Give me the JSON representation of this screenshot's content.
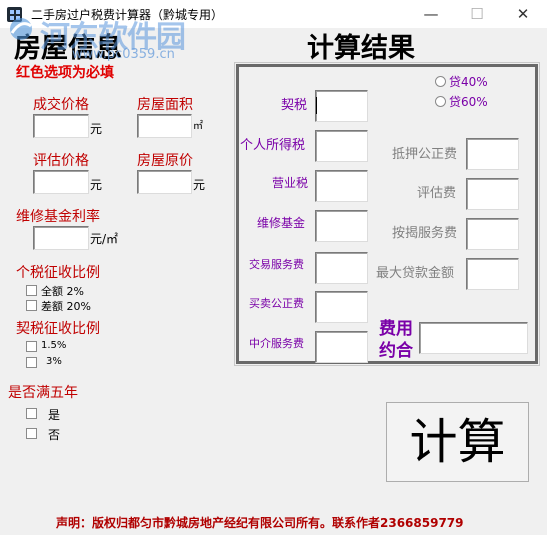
{
  "window": {
    "title": "二手房过户税费计算器（黔城专用）",
    "min": "—",
    "max": "☐",
    "close": "✕"
  },
  "watermark": {
    "text": "河东软件园",
    "url": "www.pc0359.cn"
  },
  "left": {
    "heading": "房屋信息",
    "required_note": "红色选项为必填",
    "deal_price": {
      "label": "成交价格",
      "unit": "元",
      "value": ""
    },
    "area": {
      "label": "房屋面积",
      "unit": "㎡",
      "value": ""
    },
    "appraised_price": {
      "label": "评估价格",
      "unit": "元",
      "value": ""
    },
    "original_price": {
      "label": "房屋原价",
      "unit": "元",
      "value": ""
    },
    "maintenance_rate": {
      "label": "维修基金利率",
      "unit": "元/㎡",
      "value": ""
    },
    "income_tax_ratio": {
      "label": "个税征收比例",
      "options": [
        "全额  2%",
        "差额 20%"
      ]
    },
    "deed_tax_ratio": {
      "label": "契税征收比例",
      "options": [
        "1.5%",
        "3%"
      ]
    },
    "five_years": {
      "label": "是否满五年",
      "options": [
        "是",
        "否"
      ]
    }
  },
  "right": {
    "heading": "计算结果",
    "loan_options": [
      "贷40%",
      "贷60%"
    ],
    "fields_left": [
      "契税",
      "个人所得税",
      "营业税",
      "维修基金",
      "交易服务费",
      "买卖公正费",
      "中介服务费"
    ],
    "fields_right": [
      "抵押公正费",
      "评估费",
      "按揭服务费",
      "最大贷款金额"
    ],
    "fee_total_label": "费用约合",
    "calculate": "计算"
  },
  "footer": "声明：版权归都匀市黔城房地产经纪有限公司所有。联系作者2366859779"
}
